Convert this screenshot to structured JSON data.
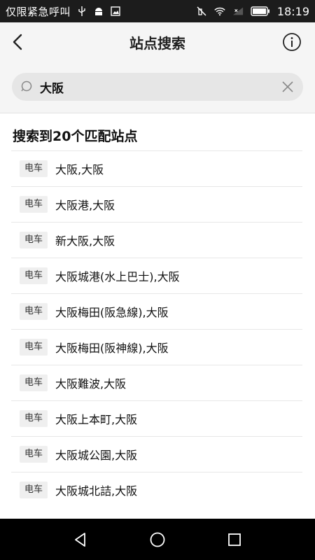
{
  "status_bar": {
    "carrier": "仅限紧急呼叫",
    "time": "18:19",
    "icons": [
      "usb-icon",
      "android-debug-icon",
      "image-icon",
      "mute-icon",
      "wifi-icon",
      "signal-icon",
      "battery-icon"
    ]
  },
  "header": {
    "title": "站点搜索",
    "back_icon": "chevron-left-icon",
    "info_icon": "info-icon"
  },
  "search": {
    "value": "大阪",
    "icon": "search-icon",
    "clear_icon": "close-icon"
  },
  "results": {
    "heading": "搜索到20个匹配站点",
    "items": [
      {
        "type": "电车",
        "name": "大阪,大阪"
      },
      {
        "type": "电车",
        "name": "大阪港,大阪"
      },
      {
        "type": "电车",
        "name": "新大阪,大阪"
      },
      {
        "type": "电车",
        "name": "大阪城港(水上巴士),大阪"
      },
      {
        "type": "电车",
        "name": "大阪梅田(阪急線),大阪"
      },
      {
        "type": "电车",
        "name": "大阪梅田(阪神線),大阪"
      },
      {
        "type": "电车",
        "name": "大阪難波,大阪"
      },
      {
        "type": "电车",
        "name": "大阪上本町,大阪"
      },
      {
        "type": "电车",
        "name": "大阪城公園,大阪"
      },
      {
        "type": "电车",
        "name": "大阪城北詰,大阪"
      }
    ]
  },
  "nav_bar": {
    "icons": [
      "back-triangle-icon",
      "home-circle-icon",
      "recents-square-icon"
    ]
  }
}
